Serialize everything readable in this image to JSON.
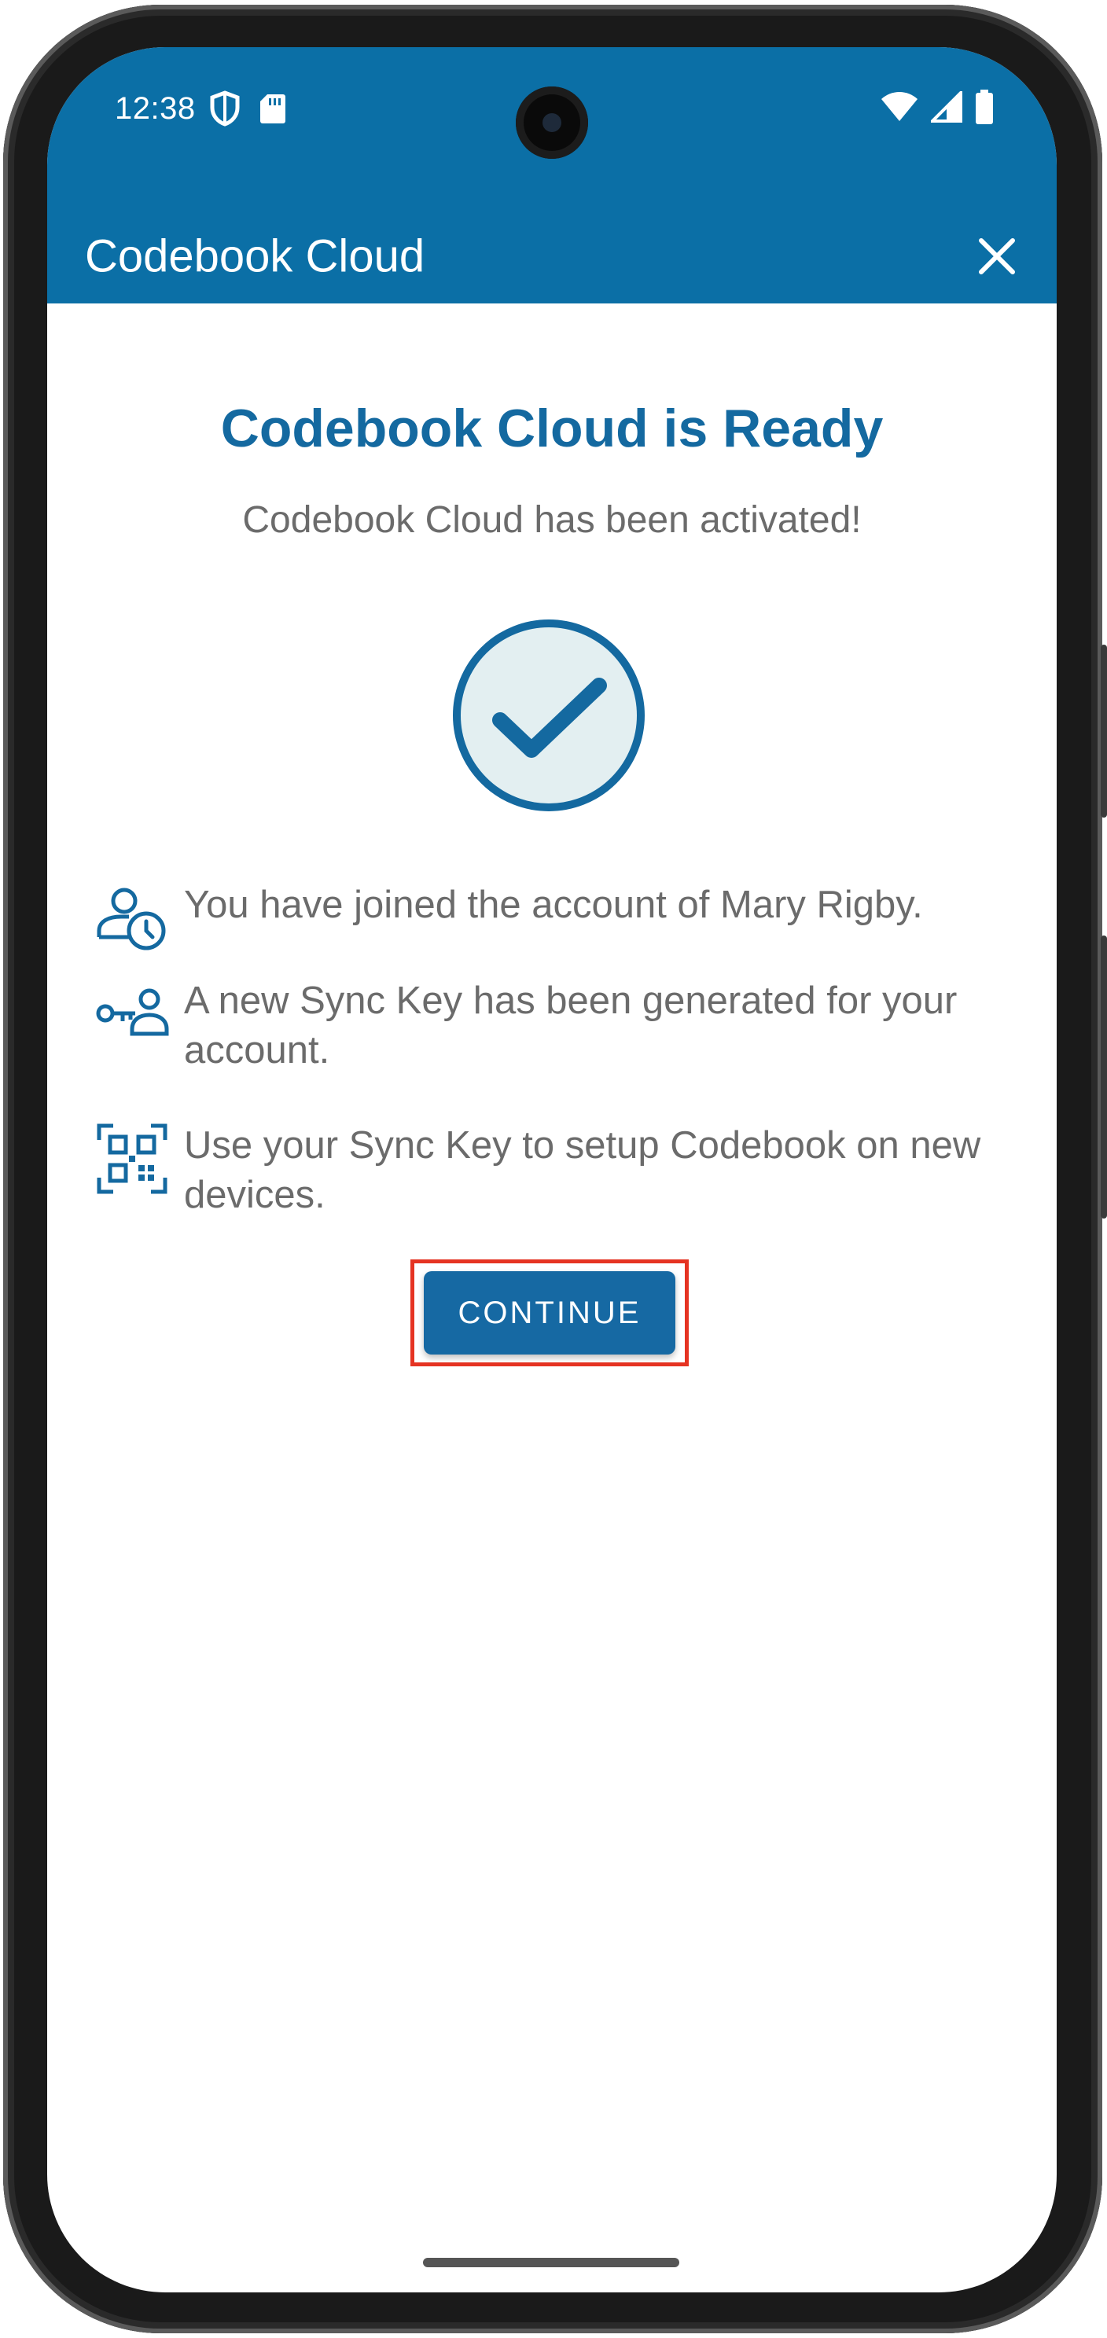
{
  "status_bar": {
    "time": "12:38",
    "left_icons": [
      "shield-icon",
      "sd-card-icon"
    ],
    "right_icons": [
      "wifi-icon",
      "signal-icon",
      "battery-icon"
    ]
  },
  "app_bar": {
    "title": "Codebook Cloud",
    "close_icon": "close-icon"
  },
  "main": {
    "heading": "Codebook Cloud is Ready",
    "subheading": "Codebook Cloud has been activated!",
    "items": [
      {
        "icon": "user-clock-icon",
        "text": "You have joined the account of Mary Rigby."
      },
      {
        "icon": "key-user-icon",
        "text": "A new Sync Key has been generated for your account."
      },
      {
        "icon": "qr-code-icon",
        "text": "Use your Sync Key to setup Codebook on new devices."
      }
    ],
    "continue_label": "CONTINUE"
  },
  "colors": {
    "primary": "#0b6fa6",
    "heading": "#1469a0",
    "text": "#6b6b6b",
    "highlight": "#e53322"
  }
}
